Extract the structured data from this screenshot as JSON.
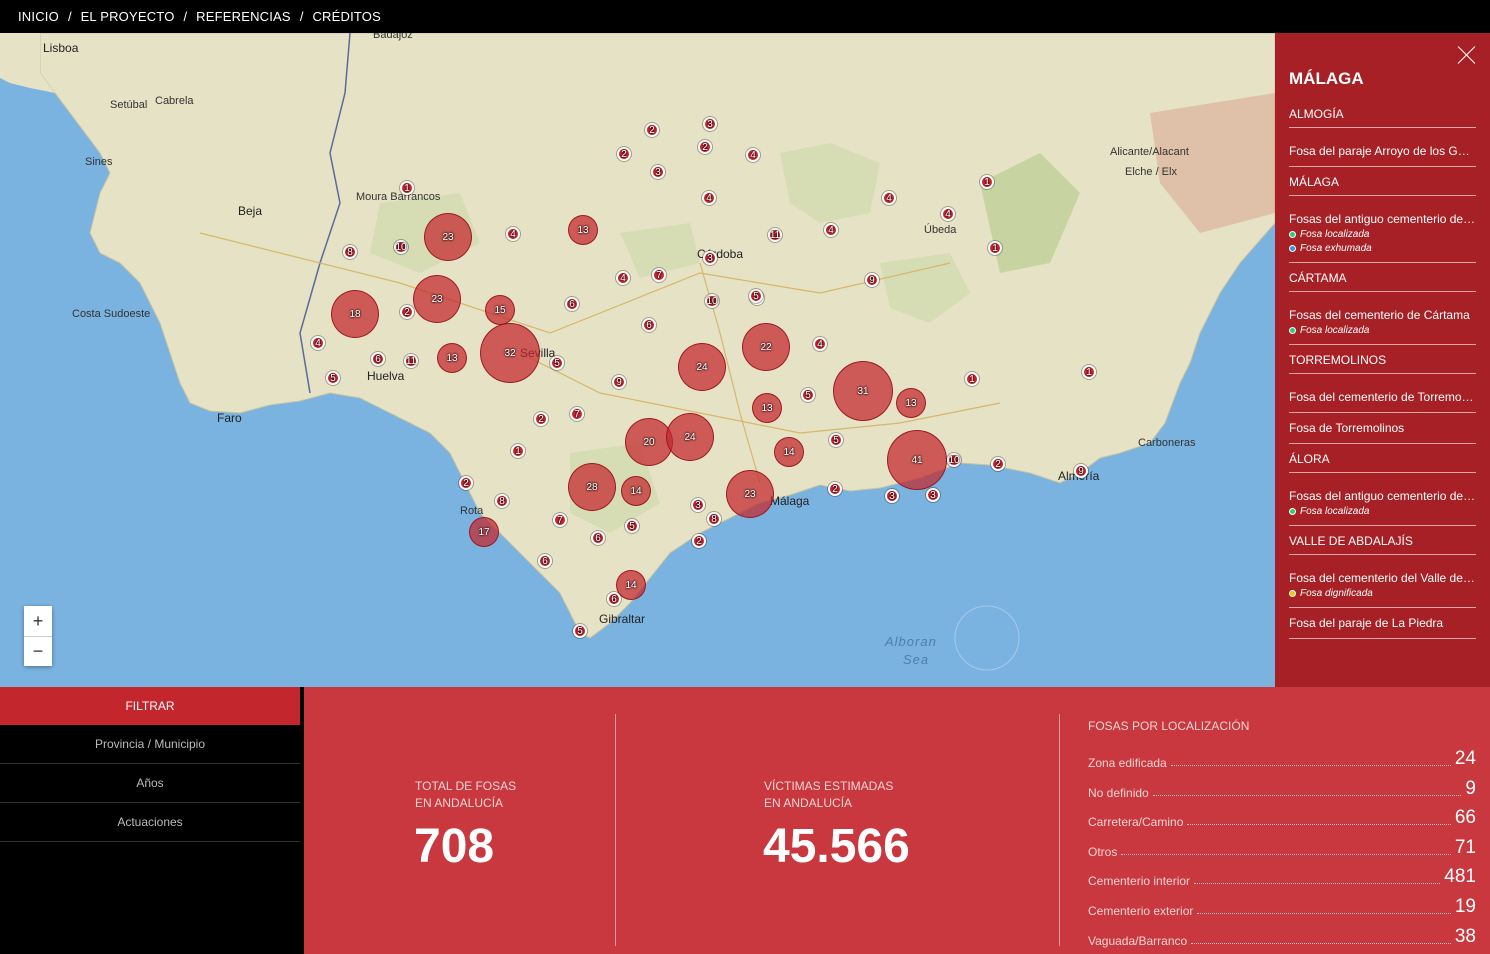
{
  "nav": {
    "items": [
      "INICIO",
      "EL PROYECTO",
      "REFERENCIAS",
      "CRÉDITOS"
    ],
    "separator": "/"
  },
  "map": {
    "labels": {
      "lisboa": "Lisboa",
      "badajoz": "Badajoz",
      "beja": "Beja",
      "faro": "Faro",
      "huelva": "Huelva",
      "sevilla": "Sevilla",
      "cordoba": "Córdoba",
      "ubeda": "Úbeda",
      "malaga": "Málaga",
      "gibraltar": "Gibraltar",
      "almeria": "Almería",
      "rota": "Rota",
      "carboneras": "Carboneras",
      "alicante": "Alicante/Alacant",
      "elche": "Elche / Elx",
      "alboran": "Alboran",
      "sea": "Sea",
      "setubal": "Setúbal",
      "cabrela": "Cabrela",
      "sines": "Sines",
      "barrancos": "Moura Barrancos",
      "costa_sudoeste": "Costa Sudoeste"
    },
    "clusters": [
      {
        "n": 1,
        "s": "small"
      },
      {
        "n": 23,
        "s": "big"
      },
      {
        "n": 10,
        "s": "small"
      },
      {
        "n": 8,
        "s": "small"
      },
      {
        "n": 4,
        "s": "small"
      },
      {
        "n": 13,
        "s": "mid"
      },
      {
        "n": 2,
        "s": "small"
      },
      {
        "n": 3,
        "s": "small"
      },
      {
        "n": 2,
        "s": "small"
      },
      {
        "n": 2,
        "s": "small"
      },
      {
        "n": 4,
        "s": "small"
      },
      {
        "n": 3,
        "s": "small"
      },
      {
        "n": 4,
        "s": "small"
      },
      {
        "n": 11,
        "s": "small"
      },
      {
        "n": 4,
        "s": "small"
      },
      {
        "n": 4,
        "s": "small"
      },
      {
        "n": 4,
        "s": "small"
      },
      {
        "n": 1,
        "s": "small"
      },
      {
        "n": 1,
        "s": "small"
      },
      {
        "n": 23,
        "s": "big"
      },
      {
        "n": 18,
        "s": "big"
      },
      {
        "n": 2,
        "s": "small"
      },
      {
        "n": 15,
        "s": "mid"
      },
      {
        "n": 6,
        "s": "small"
      },
      {
        "n": 4,
        "s": "small"
      },
      {
        "n": 7,
        "s": "small"
      },
      {
        "n": 3,
        "s": "small"
      },
      {
        "n": 10,
        "s": "small"
      },
      {
        "n": 5,
        "s": "small"
      },
      {
        "n": 9,
        "s": "small"
      },
      {
        "n": 6,
        "s": "small"
      },
      {
        "n": 4,
        "s": "small"
      },
      {
        "n": 6,
        "s": "small"
      },
      {
        "n": 11,
        "s": "small"
      },
      {
        "n": 13,
        "s": "mid"
      },
      {
        "n": 32,
        "s": "huge"
      },
      {
        "n": 5,
        "s": "small"
      },
      {
        "n": 22,
        "s": "big"
      },
      {
        "n": 4,
        "s": "small"
      },
      {
        "n": 24,
        "s": "big"
      },
      {
        "n": 5,
        "s": "small"
      },
      {
        "n": 9,
        "s": "small"
      },
      {
        "n": 31,
        "s": "huge"
      },
      {
        "n": 1,
        "s": "small"
      },
      {
        "n": 1,
        "s": "small"
      },
      {
        "n": 13,
        "s": "mid"
      },
      {
        "n": 13,
        "s": "mid"
      },
      {
        "n": 5,
        "s": "small"
      },
      {
        "n": 2,
        "s": "small"
      },
      {
        "n": 7,
        "s": "small"
      },
      {
        "n": 20,
        "s": "big"
      },
      {
        "n": 24,
        "s": "big"
      },
      {
        "n": 5,
        "s": "small"
      },
      {
        "n": 14,
        "s": "mid"
      },
      {
        "n": 41,
        "s": "huge"
      },
      {
        "n": 10,
        "s": "small"
      },
      {
        "n": 2,
        "s": "small"
      },
      {
        "n": 1,
        "s": "small"
      },
      {
        "n": 9,
        "s": "small"
      },
      {
        "n": 2,
        "s": "small"
      },
      {
        "n": 8,
        "s": "small"
      },
      {
        "n": 28,
        "s": "big"
      },
      {
        "n": 14,
        "s": "mid"
      },
      {
        "n": 23,
        "s": "big"
      },
      {
        "n": 3,
        "s": "small"
      },
      {
        "n": 2,
        "s": "small"
      },
      {
        "n": 3,
        "s": "small"
      },
      {
        "n": 3,
        "s": "small"
      },
      {
        "n": 17,
        "s": "mid"
      },
      {
        "n": 7,
        "s": "small"
      },
      {
        "n": 5,
        "s": "small"
      },
      {
        "n": 8,
        "s": "small"
      },
      {
        "n": 6,
        "s": "small"
      },
      {
        "n": 2,
        "s": "small"
      },
      {
        "n": 6,
        "s": "small"
      },
      {
        "n": 14,
        "s": "mid"
      },
      {
        "n": 6,
        "s": "small"
      },
      {
        "n": 5,
        "s": "small"
      },
      {
        "n": 5,
        "s": "small"
      }
    ],
    "zoom_in": "+",
    "zoom_out": "−"
  },
  "panel": {
    "province": "MÁLAGA",
    "groups": [
      {
        "municipio": "ALMOGÍA",
        "fosas": [
          {
            "title": "Fosa del paraje Arroyo de los Gar...",
            "status": []
          }
        ]
      },
      {
        "municipio": "MÁLAGA",
        "fosas": [
          {
            "title": "Fosas del antiguo cementerio de S...",
            "status": [
              {
                "label": "Fosa localizada",
                "color": "#2ecc71"
              },
              {
                "label": "Fosa exhumada",
                "color": "#3498db"
              }
            ]
          }
        ]
      },
      {
        "municipio": "CÁRTAMA",
        "fosas": [
          {
            "title": "Fosas del cementerio de Cártama",
            "status": [
              {
                "label": "Fosa localizada",
                "color": "#2ecc71"
              }
            ]
          }
        ]
      },
      {
        "municipio": "TORREMOLINOS",
        "fosas": [
          {
            "title": "Fosa del cementerio de Torremoli...",
            "status": []
          },
          {
            "title": "Fosa de Torremolinos",
            "status": []
          }
        ]
      },
      {
        "municipio": "ÁLORA",
        "fosas": [
          {
            "title": "Fosas del antiguo cementerio de ...",
            "status": [
              {
                "label": "Fosa localizada",
                "color": "#2ecc71"
              }
            ]
          }
        ]
      },
      {
        "municipio": "VALLE DE ABDALAJÍS",
        "fosas": [
          {
            "title": "Fosa del cementerio del Valle de A...",
            "status": [
              {
                "label": "Fosa dignificada",
                "color": "#f1c40f"
              }
            ]
          },
          {
            "title": "Fosa del paraje de La Piedra",
            "status": []
          }
        ]
      }
    ]
  },
  "filters": {
    "header": "FILTRAR",
    "items": [
      "Provincia / Municipio",
      "Años",
      "Actuaciones"
    ]
  },
  "stats": {
    "total_label_1": "TOTAL DE FOSAS",
    "total_label_2": "EN ANDALUCÍA",
    "total_value": "708",
    "victims_label_1": "VÍCTIMAS ESTIMADAS",
    "victims_label_2": "EN ANDALUCÍA",
    "victims_value": "45.566",
    "loc_title": "FOSAS POR LOCALIZACIÓN",
    "locations": [
      {
        "label": "Zona edificada",
        "value": "24"
      },
      {
        "label": "No definido",
        "value": "9"
      },
      {
        "label": "Carretera/Camino",
        "value": "66"
      },
      {
        "label": "Otros",
        "value": "71"
      },
      {
        "label": "Cementerio interior",
        "value": "481"
      },
      {
        "label": "Cementerio exterior",
        "value": "19"
      },
      {
        "label": "Vaguada/Barranco",
        "value": "38"
      }
    ]
  }
}
